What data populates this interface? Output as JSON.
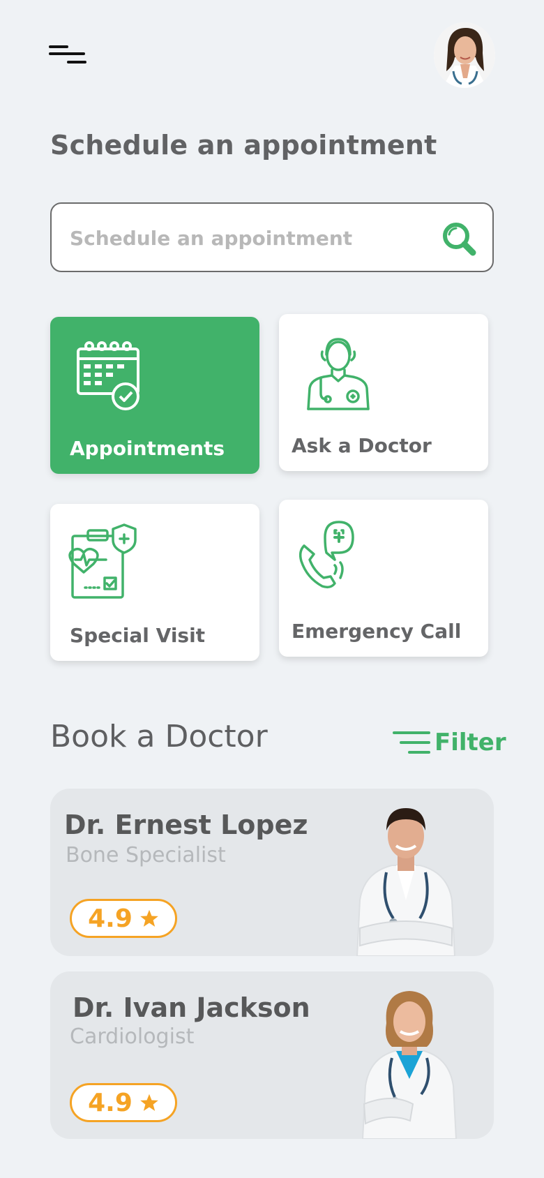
{
  "header": {
    "title": "Schedule an appointment"
  },
  "search": {
    "placeholder": "Schedule an appointment",
    "value": ""
  },
  "categories": [
    {
      "label": "Appointments",
      "icon": "calendar-check-icon",
      "active": true
    },
    {
      "label": "Ask a Doctor",
      "icon": "doctor-icon",
      "active": false
    },
    {
      "label": "Special Visit",
      "icon": "clipboard-health-icon",
      "active": false
    },
    {
      "label": "Emergency Call",
      "icon": "emergency-phone-icon",
      "active": false
    }
  ],
  "book": {
    "title": "Book a Doctor",
    "filter_label": "Filter"
  },
  "doctors": [
    {
      "name": "Dr. Ernest Lopez",
      "specialty": "Bone Specialist",
      "rating": "4.9"
    },
    {
      "name": "Dr. Ivan Jackson",
      "specialty": "Cardiologist",
      "rating": "4.9"
    }
  ],
  "colors": {
    "accent": "#41b26a",
    "rating": "#f5a324",
    "background": "#eff2f5",
    "card": "#e4e7ea"
  }
}
